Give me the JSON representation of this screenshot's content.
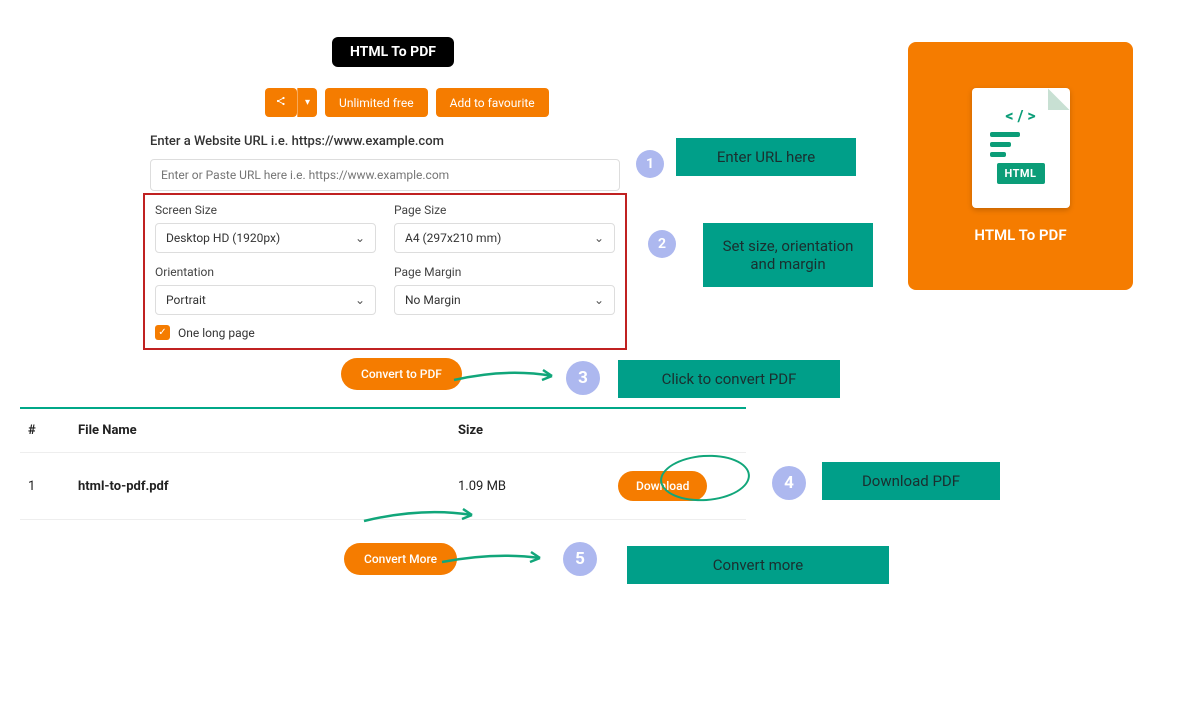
{
  "header": {
    "title_pill": "HTML To PDF",
    "buttons": {
      "unlimited": "Unlimited free",
      "favourite": "Add to favourite"
    }
  },
  "form": {
    "url_label": "Enter a Website URL i.e. https://www.example.com",
    "url_placeholder": "Enter or Paste URL here i.e. https://www.example.com",
    "fields": {
      "screen_size": {
        "label": "Screen Size",
        "value": "Desktop HD (1920px)"
      },
      "page_size": {
        "label": "Page Size",
        "value": "A4 (297x210 mm)"
      },
      "orientation": {
        "label": "Orientation",
        "value": "Portrait"
      },
      "page_margin": {
        "label": "Page Margin",
        "value": "No Margin"
      }
    },
    "one_long_page": "One long page",
    "convert_btn": "Convert to PDF"
  },
  "table": {
    "headers": {
      "num": "#",
      "file": "File Name",
      "size": "Size"
    },
    "rows": [
      {
        "num": "1",
        "file": "html-to-pdf.pdf",
        "size": "1.09 MB",
        "download": "Download"
      }
    ]
  },
  "convert_more": "Convert More",
  "annotations": {
    "n1": "1",
    "t1": "Enter URL here",
    "n2": "2",
    "t2": "Set size, orientation and margin",
    "n3": "3",
    "t3": "Click to convert PDF",
    "n4": "4",
    "t4": "Download PDF",
    "n5": "5",
    "t5": "Convert more"
  },
  "promo": {
    "badge": "HTML",
    "title": "HTML To PDF",
    "code": "< / >"
  }
}
